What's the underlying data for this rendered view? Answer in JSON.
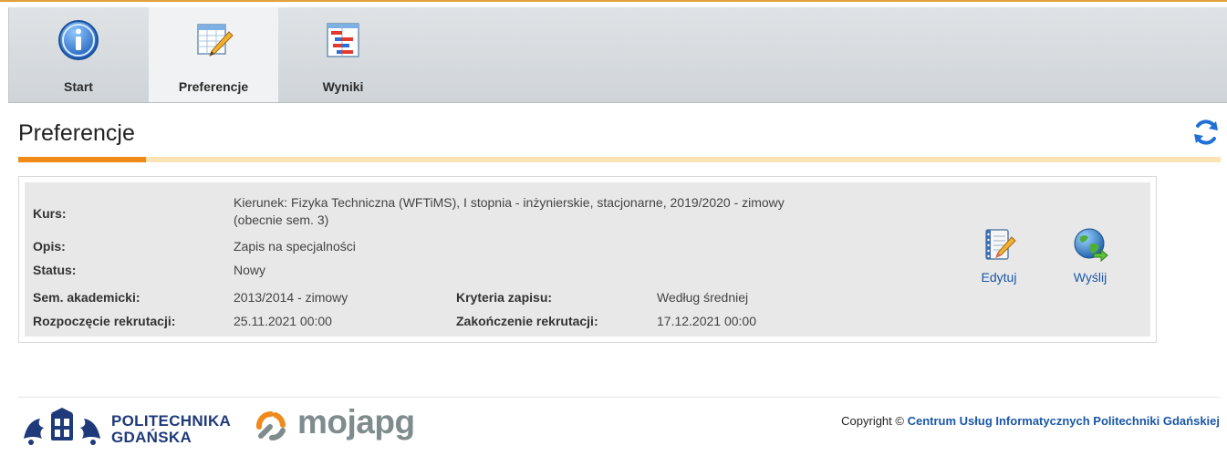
{
  "nav": {
    "tabs": [
      {
        "label": "Start",
        "icon": "info-icon"
      },
      {
        "label": "Preferencje",
        "icon": "preferences-icon",
        "active": true
      },
      {
        "label": "Wyniki",
        "icon": "results-icon"
      }
    ]
  },
  "page": {
    "title": "Preferencje",
    "refresh_icon": "refresh-icon"
  },
  "details": {
    "kurs_label": "Kurs:",
    "kurs_line1": "Kierunek: Fizyka Techniczna (WFTiMS), I stopnia - inżynierskie, stacjonarne, 2019/2020  - zimowy",
    "kurs_line2": "(obecnie sem. 3)",
    "opis_label": "Opis:",
    "opis_value": "Zapis na specjalności",
    "status_label": "Status:",
    "status_value": "Nowy",
    "sem_label": "Sem. akademicki:",
    "sem_value": "2013/2014 - zimowy",
    "kryteria_label": "Kryteria zapisu:",
    "kryteria_value": "Według średniej",
    "start_label": "Rozpoczęcie rekrutacji:",
    "start_value": "25.11.2021 00:00",
    "end_label": "Zakończenie rekrutacji:",
    "end_value": "17.12.2021 00:00"
  },
  "actions": {
    "edit_label": "Edytuj",
    "send_label": "Wyślij"
  },
  "footer": {
    "pg_line1": "POLITECHNIKA",
    "pg_line2": "GDAŃSKA",
    "moja_text": "mojapg",
    "copyright_prefix": "Copyright © ",
    "copyright_link": "Centrum Usług Informatycznych Politechniki Gdańskiej"
  },
  "colors": {
    "accent_orange": "#ef8a17",
    "link_blue": "#1a57a8",
    "pg_blue": "#1f3a7a"
  }
}
